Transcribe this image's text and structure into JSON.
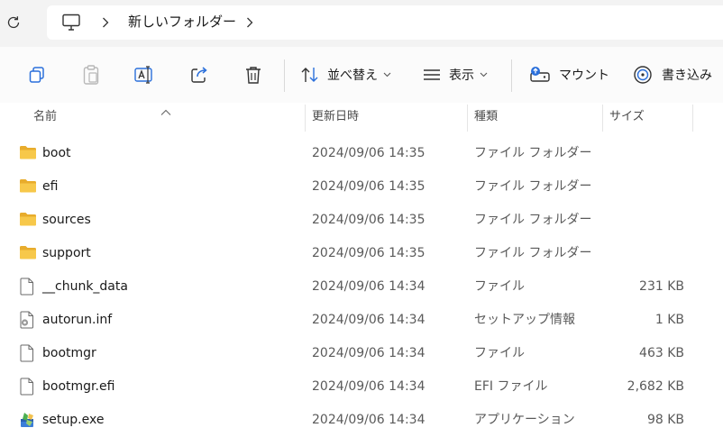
{
  "address": {
    "refresh_icon": "refresh-icon",
    "pc_icon": "this-pc-icon",
    "folder": "新しいフォルダー"
  },
  "toolbar": {
    "sort_label": "並べ替え",
    "view_label": "表示",
    "mount_label": "マウント",
    "burn_label": "書き込み"
  },
  "header": {
    "name": "名前",
    "date": "更新日時",
    "type": "種類",
    "size": "サイズ"
  },
  "files": [
    {
      "name": "boot",
      "date": "2024/09/06 14:35",
      "type": "ファイル フォルダー",
      "size": "",
      "icon": "folder-icon"
    },
    {
      "name": "efi",
      "date": "2024/09/06 14:35",
      "type": "ファイル フォルダー",
      "size": "",
      "icon": "folder-icon"
    },
    {
      "name": "sources",
      "date": "2024/09/06 14:35",
      "type": "ファイル フォルダー",
      "size": "",
      "icon": "folder-icon"
    },
    {
      "name": "support",
      "date": "2024/09/06 14:35",
      "type": "ファイル フォルダー",
      "size": "",
      "icon": "folder-icon"
    },
    {
      "name": "__chunk_data",
      "date": "2024/09/06 14:34",
      "type": "ファイル",
      "size": "231 KB",
      "icon": "file-icon"
    },
    {
      "name": "autorun.inf",
      "date": "2024/09/06 14:34",
      "type": "セットアップ情報",
      "size": "1 KB",
      "icon": "setup-info-icon"
    },
    {
      "name": "bootmgr",
      "date": "2024/09/06 14:34",
      "type": "ファイル",
      "size": "463 KB",
      "icon": "file-icon"
    },
    {
      "name": "bootmgr.efi",
      "date": "2024/09/06 14:34",
      "type": "EFI ファイル",
      "size": "2,682 KB",
      "icon": "file-icon"
    },
    {
      "name": "setup.exe",
      "date": "2024/09/06 14:34",
      "type": "アプリケーション",
      "size": "98 KB",
      "icon": "setup-exe-icon"
    }
  ],
  "colors": {
    "folder": "#f7c84a",
    "folder_dark": "#e8ac2c",
    "accent": "#2a6fdb",
    "icon_stroke": "#3a3a3a"
  }
}
